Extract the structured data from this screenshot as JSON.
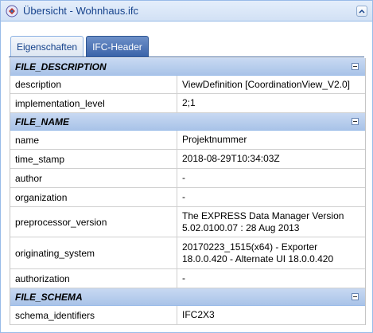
{
  "window": {
    "title": "Übersicht - Wohnhaus.ifc"
  },
  "tabs": [
    {
      "label": "Eigenschaften",
      "active": false
    },
    {
      "label": "IFC-Header",
      "active": true
    }
  ],
  "groups": [
    {
      "name": "FILE_DESCRIPTION",
      "rows": [
        {
          "key": "description",
          "value": "ViewDefinition [CoordinationView_V2.0]"
        },
        {
          "key": "implementation_level",
          "value": "2;1"
        }
      ]
    },
    {
      "name": "FILE_NAME",
      "rows": [
        {
          "key": "name",
          "value": "Projektnummer"
        },
        {
          "key": "time_stamp",
          "value": "2018-08-29T10:34:03Z"
        },
        {
          "key": "author",
          "value": "-"
        },
        {
          "key": "organization",
          "value": "-"
        },
        {
          "key": "preprocessor_version",
          "value": "The EXPRESS Data Manager Version 5.02.0100.07 : 28 Aug 2013"
        },
        {
          "key": "originating_system",
          "value": "20170223_1515(x64) - Exporter 18.0.0.420 - Alternate UI 18.0.0.420"
        },
        {
          "key": "authorization",
          "value": "-"
        }
      ]
    },
    {
      "name": "FILE_SCHEMA",
      "rows": [
        {
          "key": "schema_identifiers",
          "value": "IFC2X3"
        }
      ]
    }
  ],
  "colors": {
    "header_gradient_top": "#c8d9f2",
    "header_gradient_bottom": "#a9c3e8",
    "active_tab": "#3a63a9",
    "title_text": "#15428b"
  },
  "icons": {
    "app": "ifc-app-icon",
    "collapse": "chevron-up-icon",
    "group_toggle": "minus-icon"
  }
}
